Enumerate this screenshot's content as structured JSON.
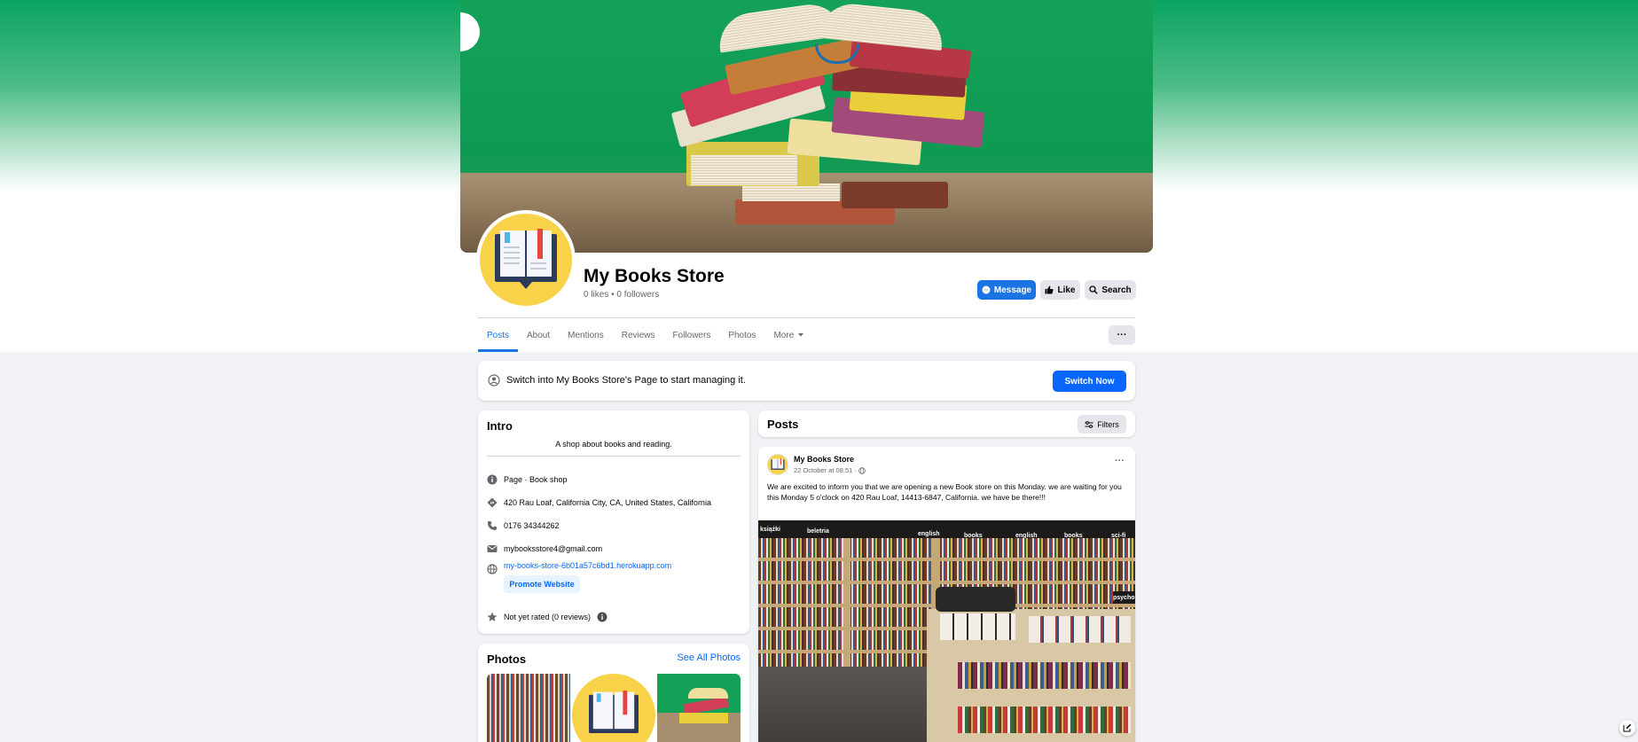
{
  "page": {
    "name": "My Books Store",
    "stats": "0 likes • 0 followers"
  },
  "header_buttons": {
    "message": "Message",
    "like": "Like",
    "search": "Search"
  },
  "tabs": [
    {
      "label": "Posts",
      "active": true
    },
    {
      "label": "About"
    },
    {
      "label": "Mentions"
    },
    {
      "label": "Reviews"
    },
    {
      "label": "Followers"
    },
    {
      "label": "Photos"
    },
    {
      "label": "More"
    }
  ],
  "more_menu_label": "···",
  "switch_banner": {
    "text": "Switch into My Books Store's Page to start managing it.",
    "button": "Switch Now"
  },
  "intro": {
    "heading": "Intro",
    "description": "A shop about books and reading.",
    "category": "Page · Book shop",
    "address": "420 Rau Loaf, California City, CA, United States, California",
    "phone": "0176 34344262",
    "email": "mybooksstore4@gmail.com",
    "website": "my-books-store-6b01a57c6bd1.herokuapp.com",
    "promote_button": "Promote Website",
    "rating": "Not yet rated (0 reviews)"
  },
  "photos": {
    "heading": "Photos",
    "see_all": "See All Photos"
  },
  "posts": {
    "heading": "Posts",
    "filters": "Filters",
    "items": [
      {
        "author": "My Books Store",
        "time": "22 October at 08:51 ·",
        "text": "We are excited to inform you that we are opening a new  Book store on this Monday. we are waiting  for you this Monday 5 o'clock on 420 Rau Loaf, 14413-6847, California. we have be there!!!",
        "image_signs": [
          "książki",
          "beletria",
          "english",
          "books",
          "english",
          "books",
          "sci-fi",
          "psychologia"
        ]
      }
    ]
  },
  "colors": {
    "brand_blue": "#1b74e4",
    "switch_blue": "#0866ff",
    "cover_green": "#0e9a52",
    "logo_yellow": "#f8d34a"
  }
}
